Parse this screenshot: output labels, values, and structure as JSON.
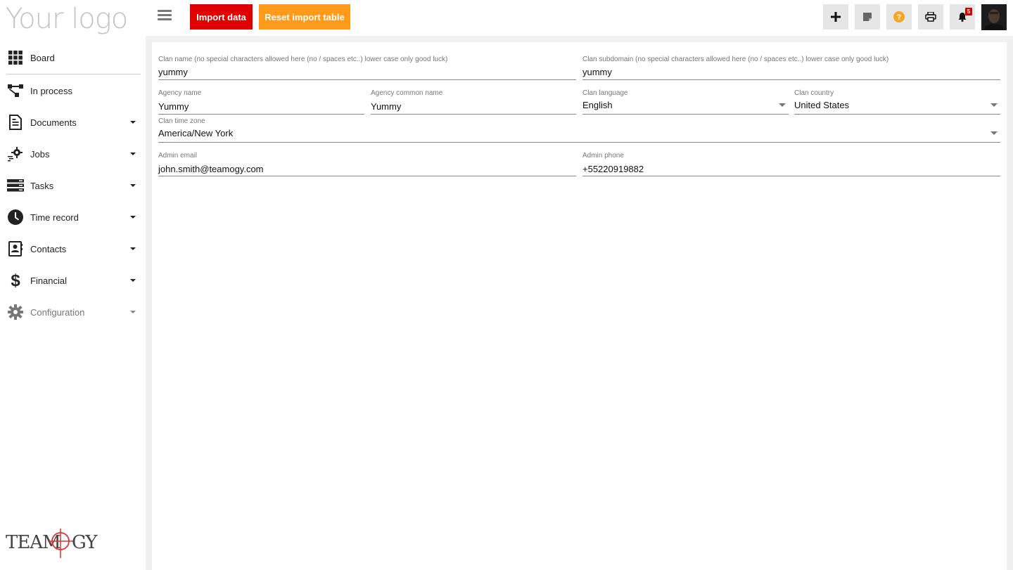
{
  "header": {
    "logo_text": "Your logo",
    "import_label": "Import data",
    "reset_label": "Reset import table",
    "notification_count": "5",
    "colors": {
      "import": "#e00000",
      "reset": "#ff9a1a",
      "help": "#f5a623",
      "badge": "#d40000"
    }
  },
  "toolbar": {
    "icons": [
      "plus-icon",
      "note-icon",
      "help-icon",
      "printer-icon",
      "bell-icon",
      "avatar"
    ]
  },
  "sidebar": {
    "items": [
      {
        "label": "Board",
        "icon": "grid-icon",
        "has_caret": false
      },
      {
        "label": "In process",
        "icon": "process-flow-icon",
        "has_caret": false
      },
      {
        "label": "Documents",
        "icon": "document-icon",
        "has_caret": true
      },
      {
        "label": "Jobs",
        "icon": "jobs-gear-icon",
        "has_caret": true
      },
      {
        "label": "Tasks",
        "icon": "tasks-icon",
        "has_caret": true
      },
      {
        "label": "Time record",
        "icon": "clock-icon",
        "has_caret": true
      },
      {
        "label": "Contacts",
        "icon": "contact-book-icon",
        "has_caret": true
      },
      {
        "label": "Financial",
        "icon": "dollar-icon",
        "has_caret": true
      },
      {
        "label": "Configuration",
        "icon": "settings-gear-icon",
        "has_caret": true
      }
    ],
    "brand": "TEAMOGY"
  },
  "form": {
    "clan_name": {
      "label": "Clan name (no special characters allowed here (no / spaces etc..) lower case only good luck)",
      "value": "yummy"
    },
    "clan_subdomain": {
      "label": "Clan subdomain (no special characters allowed here (no / spaces etc..) lower case only good luck)",
      "value": "yummy"
    },
    "agency_name": {
      "label": "Agency name",
      "value": "Yummy"
    },
    "agency_common_name": {
      "label": "Agency common name",
      "value": "Yummy"
    },
    "clan_language": {
      "label": "Clan language",
      "value": "English"
    },
    "clan_country": {
      "label": "Clan country",
      "value": "United States"
    },
    "clan_time_zone": {
      "label": "Clan time zone",
      "value": "America/New York"
    },
    "admin_email": {
      "label": "Admin email",
      "value": "john.smith@teamogy.com"
    },
    "admin_phone": {
      "label": "Admin phone",
      "value": "+55220919882"
    }
  }
}
